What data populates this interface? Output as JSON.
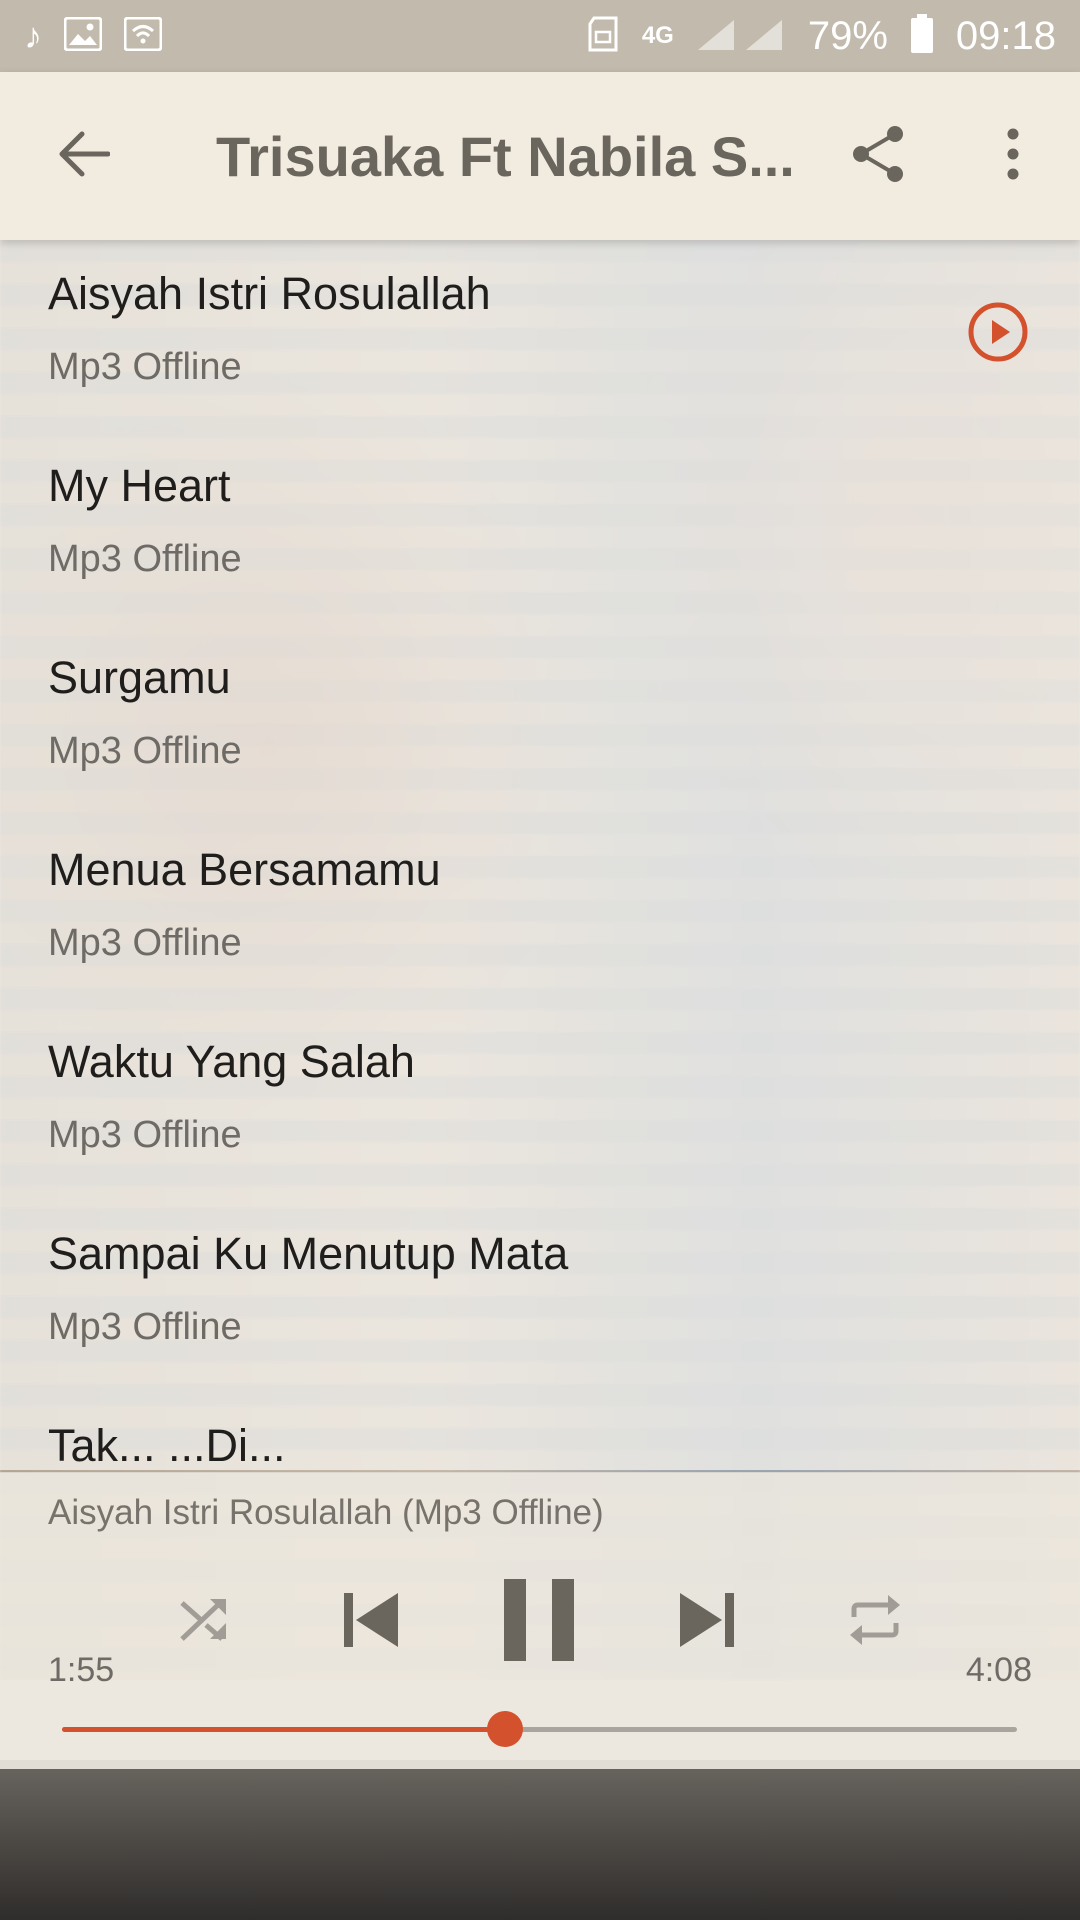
{
  "status_bar": {
    "battery": "79%",
    "time": "09:18",
    "network": "4G",
    "icons": [
      "music-note-icon",
      "gallery-icon",
      "wifi-icon",
      "cast-icon",
      "signal-icon",
      "battery-icon"
    ]
  },
  "toolbar": {
    "title": "Trisuaka Ft Nabila S...",
    "back_icon": "arrow-back-icon",
    "share_icon": "share-icon",
    "menu_icon": "more-vert-icon"
  },
  "tracks": [
    {
      "title": "Aisyah Istri Rosulallah",
      "subtitle": "Mp3 Offline",
      "playing": true
    },
    {
      "title": "My Heart",
      "subtitle": "Mp3 Offline"
    },
    {
      "title": "Surgamu",
      "subtitle": "Mp3 Offline"
    },
    {
      "title": "Menua Bersamamu",
      "subtitle": "Mp3 Offline"
    },
    {
      "title": "Waktu Yang Salah",
      "subtitle": "Mp3 Offline"
    },
    {
      "title": "Sampai Ku Menutup Mata",
      "subtitle": "Mp3 Offline"
    },
    {
      "title": "Tak... ...Di...",
      "subtitle": ""
    }
  ],
  "player": {
    "now_playing": "Aisyah Istri Rosulallah (Mp3 Offline)",
    "elapsed": "1:55",
    "duration": "4:08",
    "progress_fraction": 0.464,
    "controls": [
      "shuffle-icon",
      "skip-previous-icon",
      "pause-icon",
      "skip-next-icon",
      "repeat-icon"
    ]
  },
  "colors": {
    "accent": "#d4512d",
    "toolbar_bg": "#f1ebe0",
    "status_bar_bg": "#c2bbad",
    "title_text": "#6a655d"
  }
}
